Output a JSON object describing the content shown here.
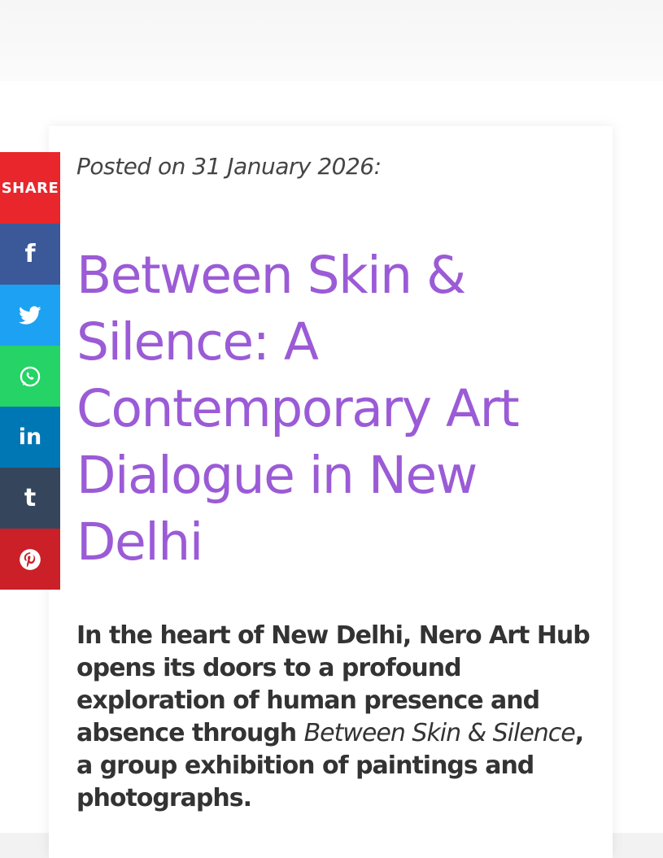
{
  "post": {
    "posted_label": "Posted on 31 January 2026:",
    "title": "Between Skin & Silence: A Contemporary Art Dialogue in New Delhi",
    "lead_part1": "In the heart of New Delhi, Nero Art Hub opens its doors to a profound exploration of human presence and absence through ",
    "lead_italic": "Between Skin & Silence",
    "lead_part2": ", a group exhibition of paintings and photographs."
  },
  "share": {
    "label": "SHARE",
    "buttons": [
      {
        "network": "facebook",
        "icon": "facebook-icon",
        "glyph": "f",
        "color": "#3b5998"
      },
      {
        "network": "twitter",
        "icon": "twitter-icon",
        "color": "#1da1f2"
      },
      {
        "network": "whatsapp",
        "icon": "whatsapp-icon",
        "color": "#25d366"
      },
      {
        "network": "linkedin",
        "icon": "linkedin-icon",
        "glyph": "in",
        "color": "#0077b5"
      },
      {
        "network": "tumblr",
        "icon": "tumblr-icon",
        "glyph": "t",
        "color": "#35465c"
      },
      {
        "network": "pinterest",
        "icon": "pinterest-icon",
        "color": "#cb2027"
      }
    ],
    "header_color": "#e8262c"
  },
  "theme": {
    "title_color": "#9b5bd6",
    "text_color": "#333333"
  }
}
